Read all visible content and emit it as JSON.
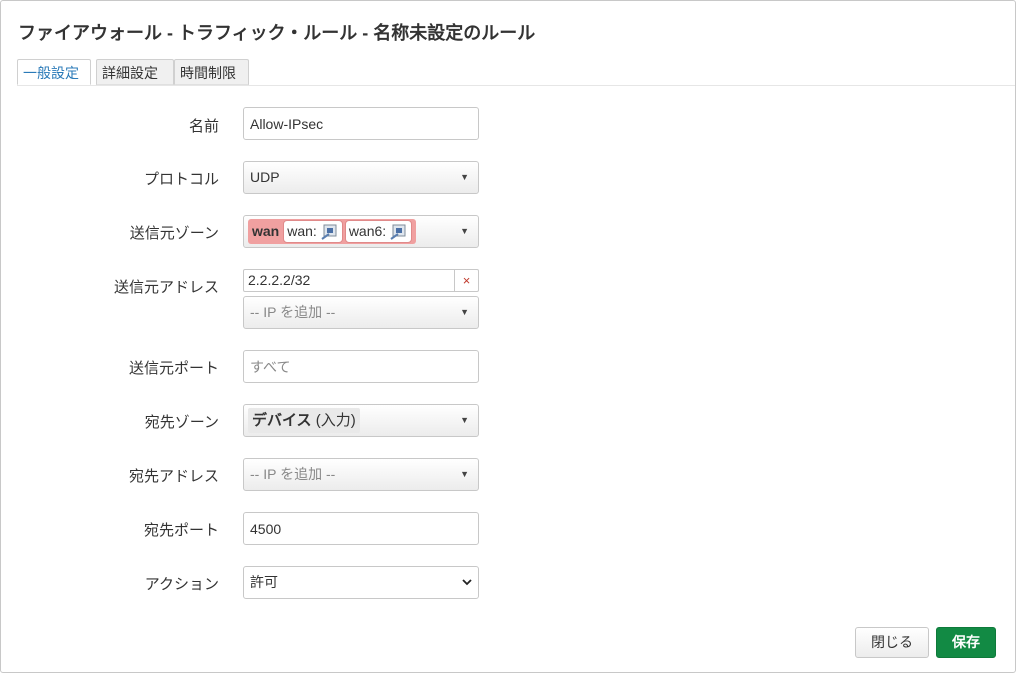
{
  "dialog": {
    "title": "ファイアウォール - トラフィック・ルール - 名称未設定のルール"
  },
  "tabs": [
    {
      "label": "一般設定",
      "active": true
    },
    {
      "label": "詳細設定",
      "active": false
    },
    {
      "label": "時間制限",
      "active": false
    }
  ],
  "form": {
    "name": {
      "label": "名前",
      "value": "Allow-IPsec"
    },
    "protocol": {
      "label": "プロトコル",
      "value": "UDP"
    },
    "src_zone": {
      "label": "送信元ゾーン",
      "zone": "wan",
      "networks": [
        {
          "name": "wan:",
          "icon": "ethernet-port-icon"
        },
        {
          "name": "wan6:",
          "icon": "ethernet-port-icon"
        }
      ]
    },
    "src_ip": {
      "label": "送信元アドレス",
      "entries": [
        "2.2.2.2/32"
      ],
      "remove_glyph": "×",
      "add_placeholder": "-- IP を追加 --"
    },
    "src_port": {
      "label": "送信元ポート",
      "placeholder": "すべて"
    },
    "dest_zone": {
      "label": "宛先ゾーン",
      "value_bold": "デバイス",
      "value_suffix": " (入力)"
    },
    "dest_ip": {
      "label": "宛先アドレス",
      "add_placeholder": "-- IP を追加 --"
    },
    "dest_port": {
      "label": "宛先ポート",
      "value": "4500"
    },
    "action": {
      "label": "アクション",
      "value": "許可"
    }
  },
  "buttons": {
    "close": "閉じる",
    "save": "保存"
  },
  "colors": {
    "zone_wan": "#f0a0a0",
    "tab_active_text": "#2a7ab8",
    "save_button": "#128a44"
  }
}
